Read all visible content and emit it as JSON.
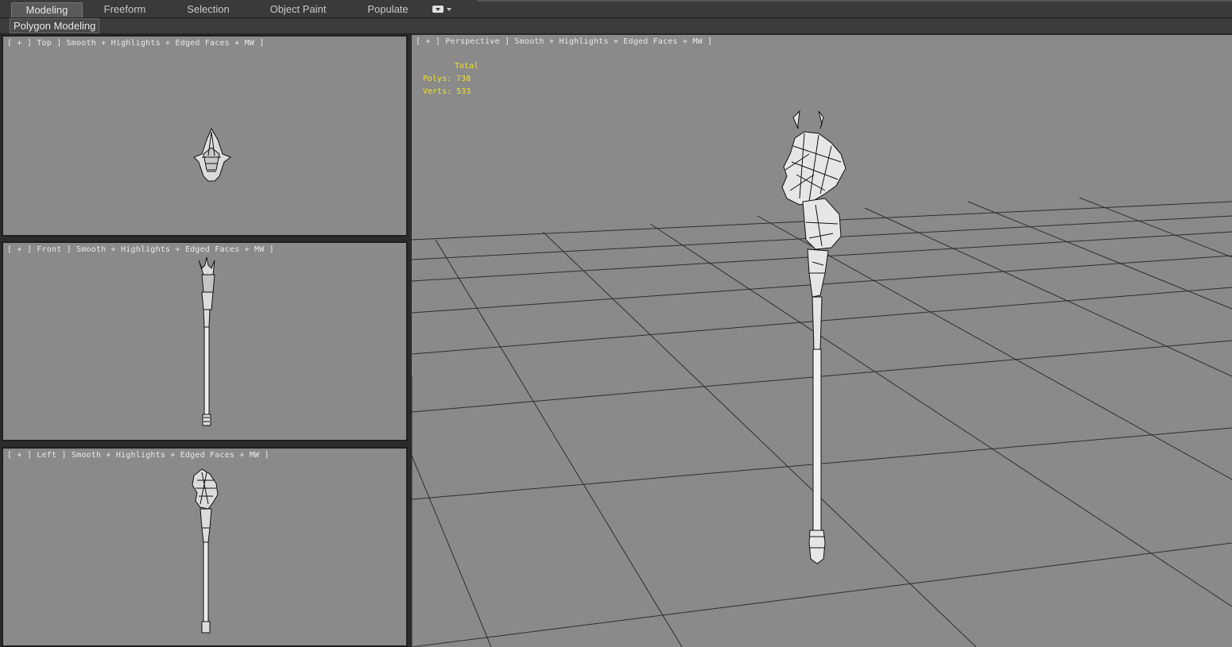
{
  "ribbon": {
    "tabs": [
      {
        "label": "Modeling",
        "active": true
      },
      {
        "label": "Freeform",
        "active": false
      },
      {
        "label": "Selection",
        "active": false
      },
      {
        "label": "Object Paint",
        "active": false
      },
      {
        "label": "Populate",
        "active": false
      }
    ],
    "sub_tab_label": "Polygon Modeling"
  },
  "viewports": {
    "top": {
      "label": "[ + ] Top ] Smooth + Highlights + Edged Faces + MW ]"
    },
    "front": {
      "label": "[ + ] Front ] Smooth + Highlights + Edged Faces + MW ]"
    },
    "left": {
      "label": "[ + ] Left ] Smooth + Highlights + Edged Faces + MW ]"
    },
    "perspective": {
      "label": "[ + ] Perspective ] Smooth + Highlights + Edged Faces + MW ]",
      "stats": {
        "header": "Total",
        "polys_label": "Polys:",
        "polys_value": "738",
        "verts_label": "Verts:",
        "verts_value": "533"
      }
    }
  },
  "colors": {
    "viewport_bg": "#8a8a8a",
    "stats_text": "#f0e030",
    "label_text": "#e8e8e8",
    "ribbon_bg": "#3a3a3a"
  }
}
